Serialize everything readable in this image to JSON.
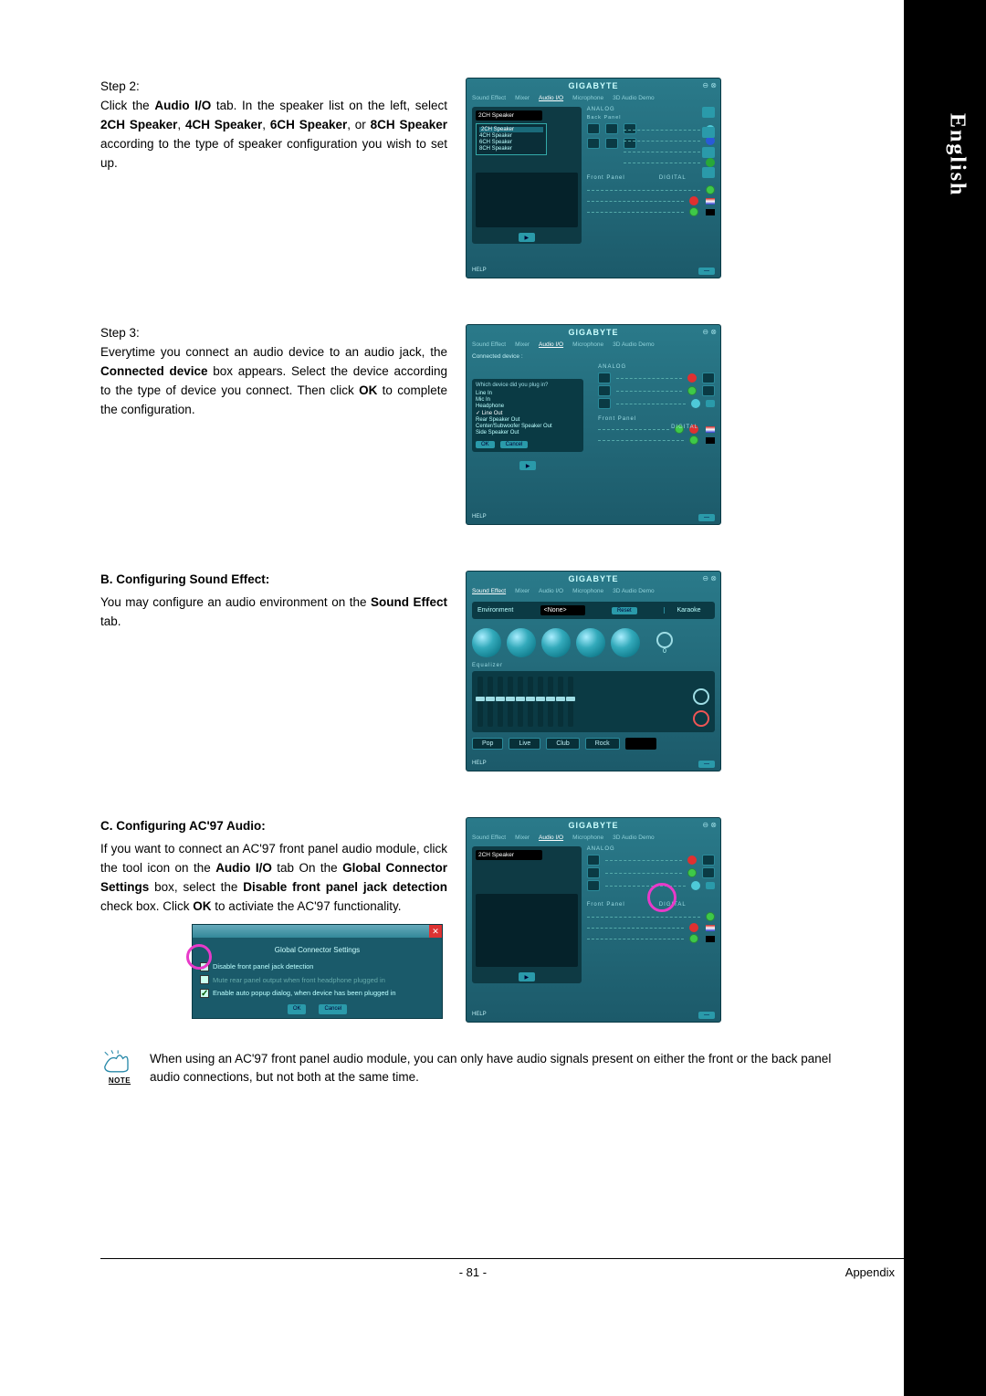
{
  "sidebar": {
    "language": "English"
  },
  "step2": {
    "title": "Step 2:",
    "t1": "Click the ",
    "b1": "Audio I/O",
    "t2": " tab. In the speaker list on the left, select ",
    "b2": "2CH Speaker",
    "t3": ", ",
    "b3": "4CH Speaker",
    "t4": ", ",
    "b4": "6CH Speaker",
    "t5": ", or ",
    "b5": "8CH Speaker",
    "t6": " according to the type of speaker configuration you wish to set up."
  },
  "step3": {
    "title": "Step 3:",
    "t1": "Everytime you connect an audio device to an audio jack, the ",
    "b1": "Connected device",
    "t2": " box appears. Select the device according to the type of device you connect. Then click ",
    "b2": "OK",
    "t3": " to complete the configuration."
  },
  "secB": {
    "heading": "B. Configuring Sound Effect:",
    "t1": "You may configure an audio environment on the ",
    "b1": "Sound Effect",
    "t2": " tab."
  },
  "secC": {
    "heading": "C. Configuring AC'97 Audio:",
    "t1": "If you want to connect an AC'97 front panel audio module, click the tool icon on the ",
    "b1": "Audio I/O",
    "t2": " tab On the ",
    "b2": "Global Connector Settings",
    "t3": " box, select the ",
    "b3": "Disable front panel jack detection",
    "t4": " check box. Click ",
    "b4": "OK",
    "t5": " to activiate the AC'97 functionality."
  },
  "shot": {
    "brand": "GIGABYTE",
    "close": "⊖ ⊗",
    "tabs": {
      "soundEffect": "Sound Effect",
      "mixer": "Mixer",
      "audioIO": "Audio I/O",
      "microphone": "Microphone",
      "demo": "3D Audio Demo"
    },
    "analog": "ANALOG",
    "backPanel": "Back Panel",
    "frontPanel": "Front Panel",
    "digital": "DIGITAL",
    "help": "HELP",
    "speakerSel": "2CH Speaker",
    "speakerOpts": {
      "o1": "2CH Speaker",
      "o2": "4CH Speaker",
      "o3": "6CH Speaker",
      "o4": "8CH Speaker"
    }
  },
  "cd": {
    "label": "Connected device :",
    "title": "Which device did you plug in?",
    "i1": "Line In",
    "i2": "Mic In",
    "i3": "Headphone",
    "i4": "Line Out",
    "i5": "Rear Speaker Out",
    "i6": "Center/Subwoofer Speaker Out",
    "i7": "Side Speaker Out",
    "ok": "OK",
    "cancel": "Cancel"
  },
  "se": {
    "env": "Environment",
    "envVal": "<None>",
    "reset": "Reset",
    "karaoke": "Karaoke",
    "kval": "0",
    "equalizer": "Equalizer",
    "p1": "Pop",
    "p2": "Live",
    "p3": "Club",
    "p4": "Rock"
  },
  "gcs": {
    "title": "Global Connector Settings",
    "c1": "Disable front panel jack detection",
    "c2": "Mute rear panel output when front headphone plugged in",
    "c3": "Enable auto popup dialog, when device has been plugged in",
    "ok": "OK",
    "cancel": "Cancel"
  },
  "note": {
    "label": "NOTE",
    "text": "When using an AC'97 front panel audio module, you can only have audio signals present on either the front or the back panel audio connections, but not both at the same time."
  },
  "footer": {
    "page": "- 81 -",
    "section": "Appendix"
  }
}
